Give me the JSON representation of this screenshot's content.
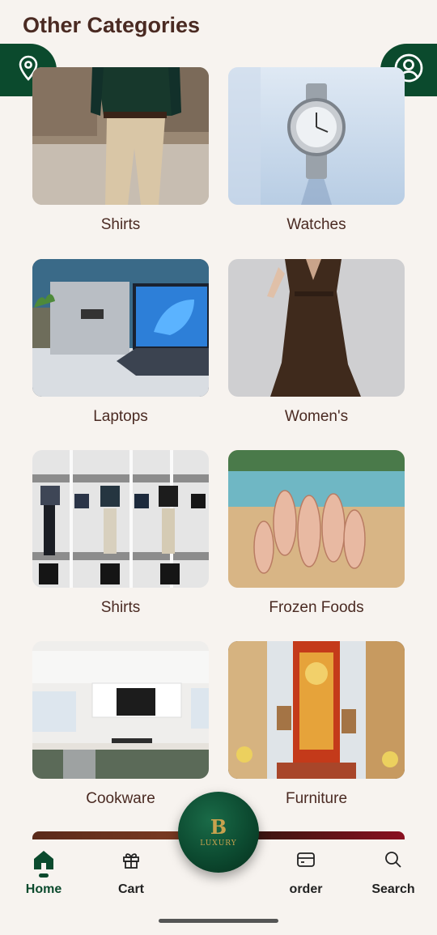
{
  "page": {
    "title": "Other Categories"
  },
  "categories": [
    {
      "label": "Shirts",
      "image": "man-in-shirt-photo"
    },
    {
      "label": "Watches",
      "image": "watch-photo"
    },
    {
      "label": "Laptops",
      "image": "laptop-photo"
    },
    {
      "label": "Women's",
      "image": "dress-photo"
    },
    {
      "label": "Shirts",
      "image": "shirt-catalog-photo"
    },
    {
      "label": "Frozen Foods",
      "image": "shrimp-photo"
    },
    {
      "label": "Cookware",
      "image": "kitchen-photo"
    },
    {
      "label": "Furniture",
      "image": "pooja-room-photo"
    }
  ],
  "fab": {
    "letter": "B",
    "text": "LUXURY"
  },
  "nav": {
    "items": [
      {
        "label": "Home",
        "icon": "home-icon",
        "active": true
      },
      {
        "label": "Cart",
        "icon": "gift-icon",
        "active": false
      },
      {
        "label": "order",
        "icon": "card-icon",
        "active": false
      },
      {
        "label": "Search",
        "icon": "search-icon",
        "active": false
      }
    ]
  },
  "colors": {
    "brand": "#0b4a2d",
    "text": "#4a2a22",
    "background": "#f7f3ef",
    "gold": "#c9a24e"
  }
}
